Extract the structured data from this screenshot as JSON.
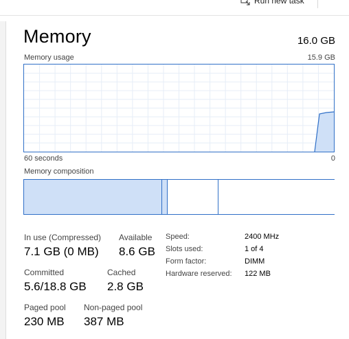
{
  "toolbar": {
    "run_new_task_label": "Run new task"
  },
  "header": {
    "title": "Memory",
    "total": "16.0 GB"
  },
  "usage_graph": {
    "label": "Memory usage",
    "max_label": "15.9 GB",
    "time_label": "60 seconds",
    "min_label": "0",
    "accent_color": "#2f6fc7",
    "fill_color": "#cfe0f7"
  },
  "composition": {
    "label": "Memory composition",
    "in_use_fraction": 0.445,
    "modified_fraction": 0.017,
    "standby_fraction": 0.163,
    "free_fraction": 0.375
  },
  "stats": {
    "in_use_label": "In use (Compressed)",
    "in_use_value": "7.1 GB (0 MB)",
    "available_label": "Available",
    "available_value": "8.6 GB",
    "committed_label": "Committed",
    "committed_value": "5.6/18.8 GB",
    "cached_label": "Cached",
    "cached_value": "2.8 GB",
    "paged_pool_label": "Paged pool",
    "paged_pool_value": "230 MB",
    "non_paged_pool_label": "Non-paged pool",
    "non_paged_pool_value": "387 MB"
  },
  "hardware": {
    "speed_label": "Speed:",
    "speed_value": "2400 MHz",
    "slots_label": "Slots used:",
    "slots_value": "1 of 4",
    "form_factor_label": "Form factor:",
    "form_factor_value": "DIMM",
    "reserved_label": "Hardware reserved:",
    "reserved_value": "122 MB"
  }
}
